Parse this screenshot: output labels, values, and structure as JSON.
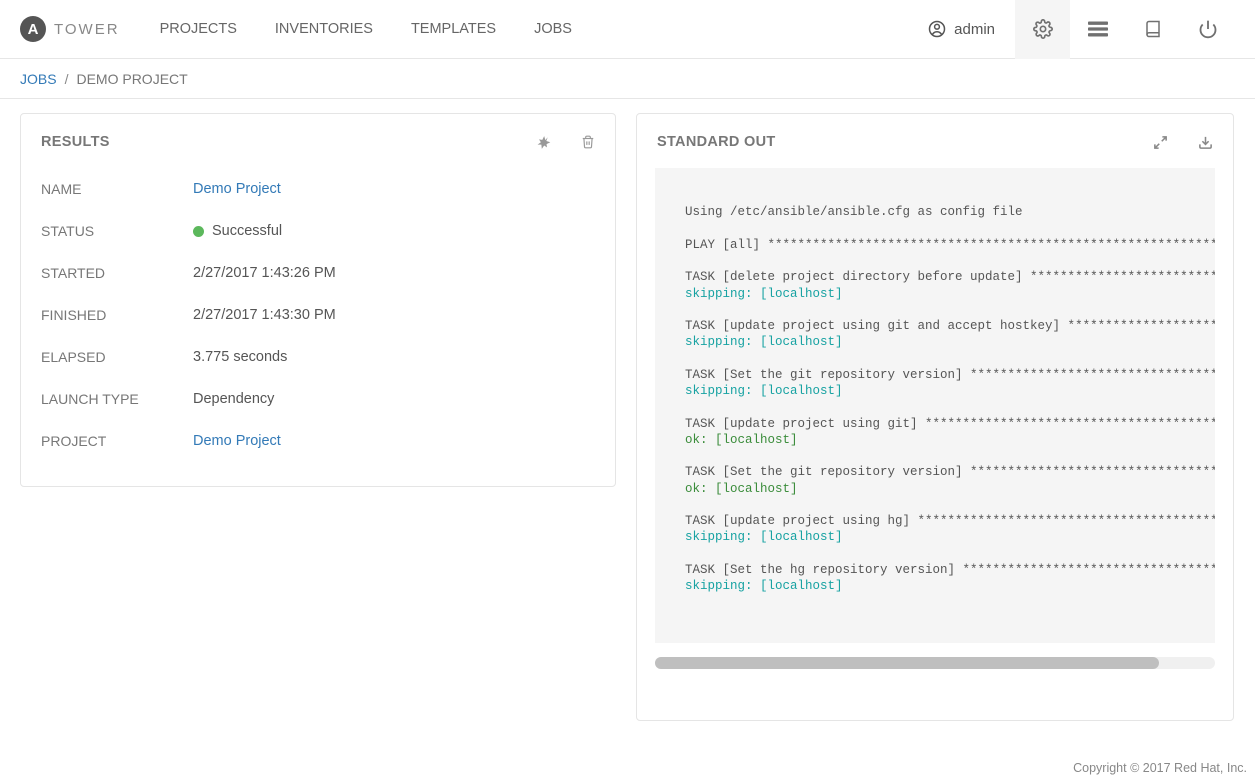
{
  "brand": {
    "letter": "A",
    "name": "TOWER"
  },
  "nav": {
    "projects": "PROJECTS",
    "inventories": "INVENTORIES",
    "templates": "TEMPLATES",
    "jobs": "JOBS"
  },
  "user": {
    "name": "admin"
  },
  "breadcrumb": {
    "parent": "JOBS",
    "current": "DEMO PROJECT"
  },
  "results": {
    "title": "RESULTS",
    "rows": {
      "name": {
        "label": "NAME",
        "value": "Demo Project"
      },
      "status": {
        "label": "STATUS",
        "value": "Successful",
        "color": "#5cb85c"
      },
      "started": {
        "label": "STARTED",
        "value": "2/27/2017 1:43:26 PM"
      },
      "finished": {
        "label": "FINISHED",
        "value": "2/27/2017 1:43:30 PM"
      },
      "elapsed": {
        "label": "ELAPSED",
        "value": "3.775 seconds"
      },
      "launch_type": {
        "label": "LAUNCH TYPE",
        "value": "Dependency"
      },
      "project": {
        "label": "PROJECT",
        "value": "Demo Project"
      }
    }
  },
  "stdout": {
    "title": "STANDARD OUT",
    "lines": [
      {
        "text": "Using /etc/ansible/ansible.cfg as config file",
        "cls": ""
      },
      {
        "text": "",
        "cls": ""
      },
      {
        "text": "PLAY [all] **********************************************************************",
        "cls": ""
      },
      {
        "text": "",
        "cls": ""
      },
      {
        "text": "TASK [delete project directory before update] **********************************",
        "cls": ""
      },
      {
        "text": "skipping: [localhost]",
        "cls": "cyan"
      },
      {
        "text": "",
        "cls": ""
      },
      {
        "text": "TASK [update project using git and accept hostkey] ******************************",
        "cls": ""
      },
      {
        "text": "skipping: [localhost]",
        "cls": "cyan"
      },
      {
        "text": "",
        "cls": ""
      },
      {
        "text": "TASK [Set the git repository version] ******************************************",
        "cls": ""
      },
      {
        "text": "skipping: [localhost]",
        "cls": "cyan"
      },
      {
        "text": "",
        "cls": ""
      },
      {
        "text": "TASK [update project using git] *************************************************",
        "cls": ""
      },
      {
        "text": "ok: [localhost]",
        "cls": "green"
      },
      {
        "text": "",
        "cls": ""
      },
      {
        "text": "TASK [Set the git repository version] ******************************************",
        "cls": ""
      },
      {
        "text": "ok: [localhost]",
        "cls": "green"
      },
      {
        "text": "",
        "cls": ""
      },
      {
        "text": "TASK [update project using hg] *************************************************",
        "cls": ""
      },
      {
        "text": "skipping: [localhost]",
        "cls": "cyan"
      },
      {
        "text": "",
        "cls": ""
      },
      {
        "text": "TASK [Set the hg repository version] *******************************************",
        "cls": ""
      },
      {
        "text": "skipping: [localhost]",
        "cls": "cyan"
      }
    ]
  },
  "footer": "Copyright © 2017 Red Hat, Inc."
}
